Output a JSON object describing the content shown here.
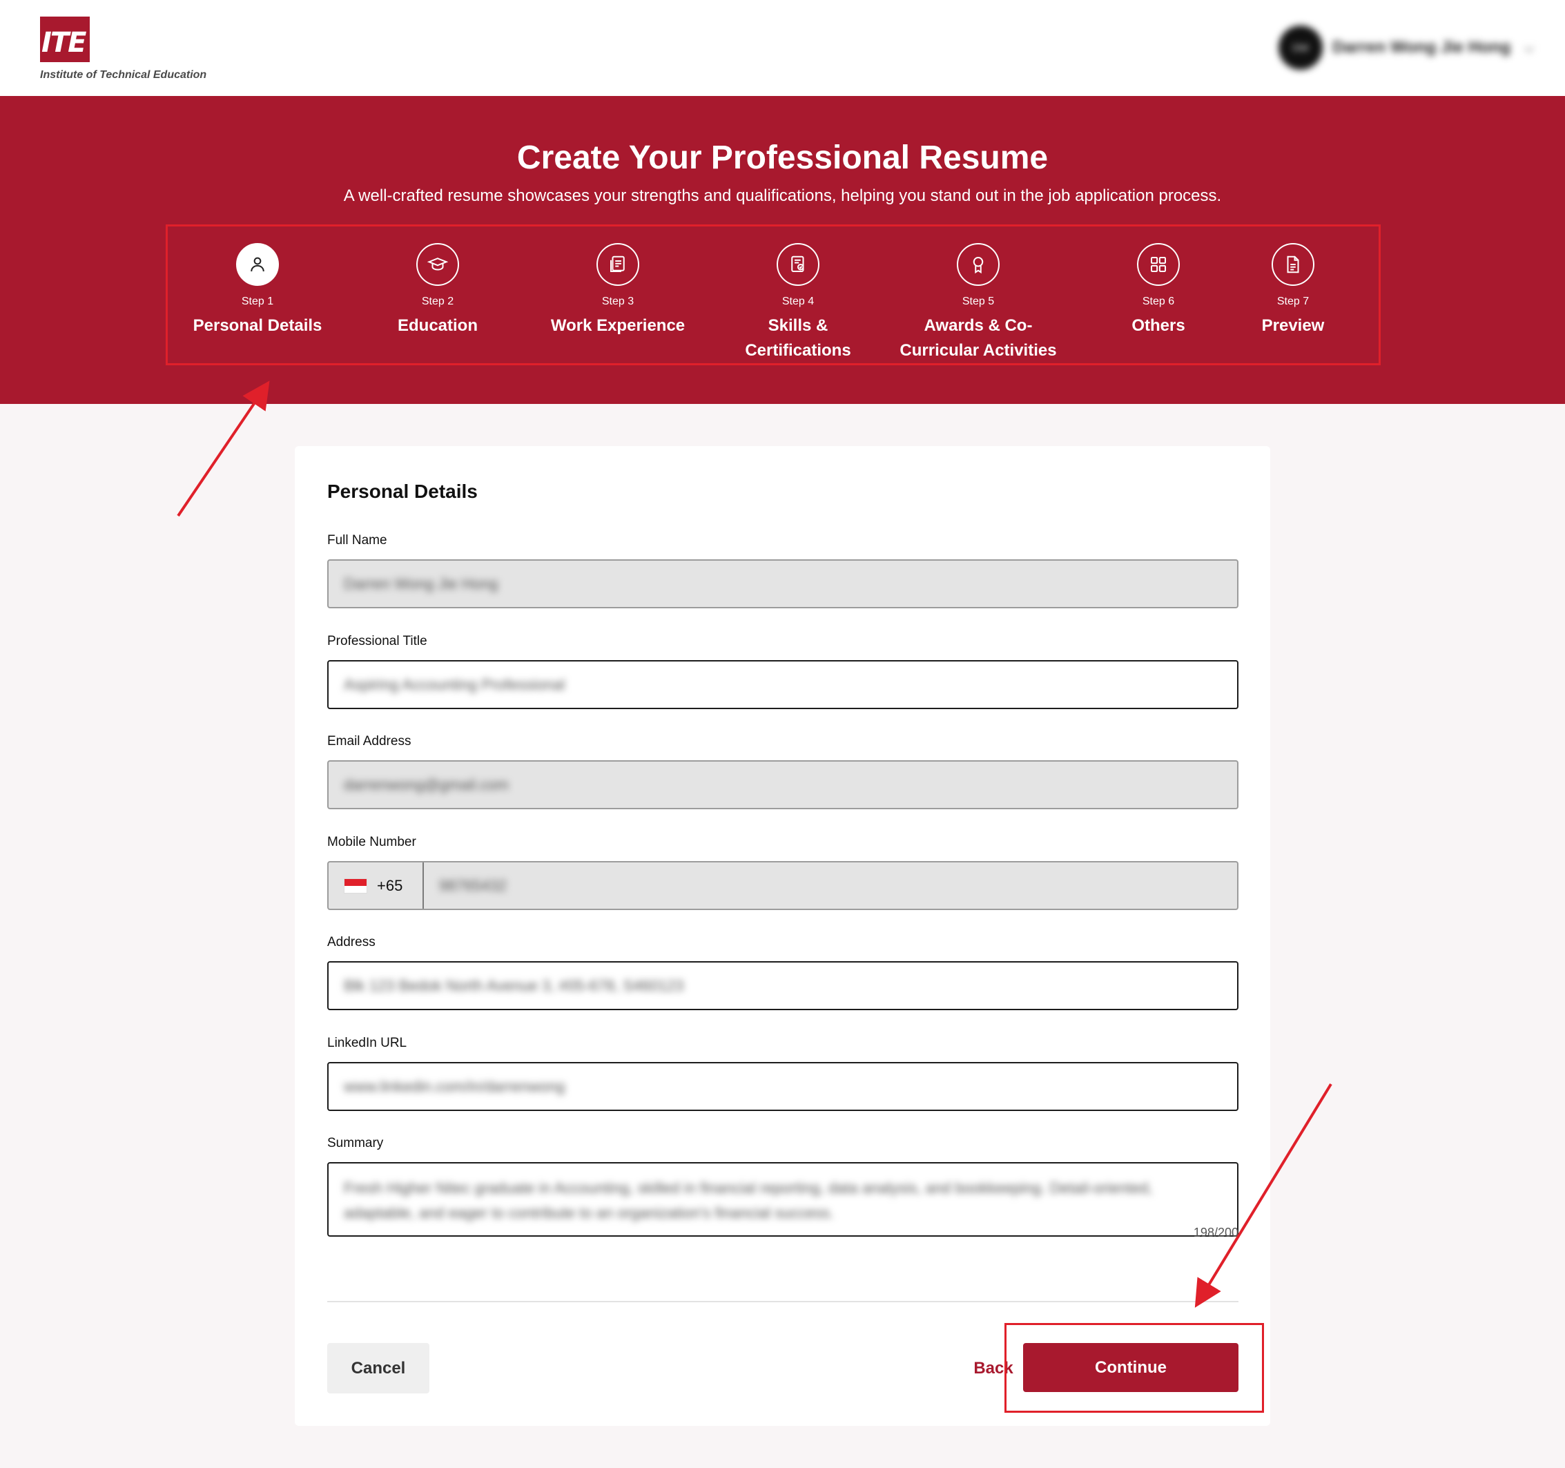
{
  "brand": {
    "logo_mark": "ITE",
    "logo_text": "Institute of Technical Education",
    "color": "#a8192e"
  },
  "user": {
    "initials": "DW",
    "name": "Darren Wong Jie Hong"
  },
  "hero": {
    "title": "Create Your Professional Resume",
    "subtitle": "A well-crafted resume showcases your strengths and qualifications, helping you stand out in the job application process."
  },
  "steps": [
    {
      "num": "Step 1",
      "label": "Personal Details",
      "icon": "user-icon",
      "active": true
    },
    {
      "num": "Step 2",
      "label": "Education",
      "icon": "graduation-cap-icon",
      "active": false
    },
    {
      "num": "Step 3",
      "label": "Work Experience",
      "icon": "clipboard-icon",
      "active": false
    },
    {
      "num": "Step 4",
      "label": "Skills & Certifications",
      "icon": "certificate-icon",
      "active": false
    },
    {
      "num": "Step 5",
      "label": "Awards & Co-Curricular Activities",
      "icon": "award-icon",
      "active": false
    },
    {
      "num": "Step 6",
      "label": "Others",
      "icon": "grid-icon",
      "active": false
    },
    {
      "num": "Step 7",
      "label": "Preview",
      "icon": "document-icon",
      "active": false
    }
  ],
  "form": {
    "title": "Personal Details",
    "full_name": {
      "label": "Full Name",
      "value": "Darren Wong Jie Hong"
    },
    "professional_title": {
      "label": "Professional Title",
      "value": "Aspiring Accounting Professional"
    },
    "email": {
      "label": "Email Address",
      "value": "darrenwong@gmail.com"
    },
    "mobile": {
      "label": "Mobile Number",
      "country_code": "+65",
      "value": "98765432"
    },
    "address": {
      "label": "Address",
      "value": "Blk 123 Bedok North Avenue 3, #05-678, S460123"
    },
    "linkedin": {
      "label": "LinkedIn URL",
      "value": "www.linkedin.com/in/darrenwong"
    },
    "summary": {
      "label": "Summary",
      "value": "Fresh Higher Nitec graduate in Accounting, skilled in financial reporting, data analysis, and bookkeeping. Detail-oriented, adaptable, and eager to contribute to an organization's financial success.",
      "counter": "198/200"
    }
  },
  "actions": {
    "cancel": "Cancel",
    "back": "Back",
    "continue": "Continue"
  }
}
